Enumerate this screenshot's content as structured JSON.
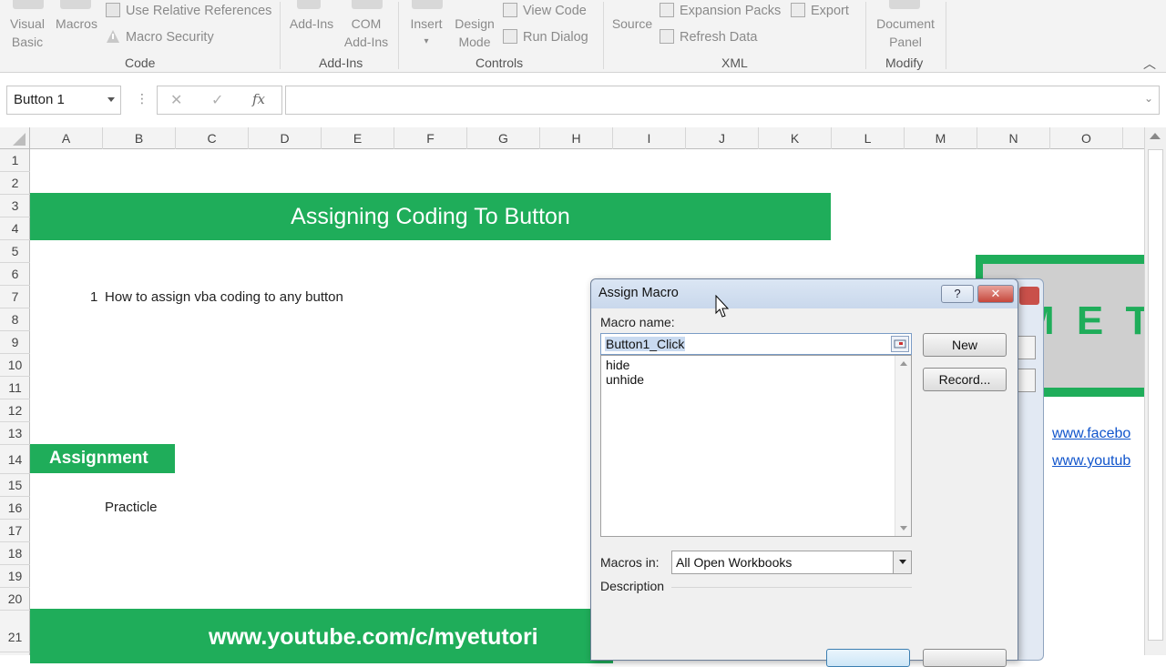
{
  "ribbon": {
    "visual_basic": [
      "Visual",
      "Basic"
    ],
    "macros": "Macros",
    "use_relative": "Use Relative References",
    "macro_security": "Macro Security",
    "group_code": "Code",
    "add_ins": "Add-Ins",
    "com_add_ins": [
      "COM",
      "Add-Ins"
    ],
    "group_addins": "Add-Ins",
    "insert": "Insert",
    "design_mode": [
      "Design",
      "Mode"
    ],
    "view_code": "View Code",
    "run_dialog": "Run Dialog",
    "group_controls": "Controls",
    "source": "Source",
    "expansion_packs": "Expansion Packs",
    "export": "Export",
    "refresh_data": "Refresh Data",
    "group_xml": "XML",
    "document_panel": [
      "Document",
      "Panel"
    ],
    "group_modify": "Modify"
  },
  "formula_bar": {
    "name_box": "Button 1",
    "cancel_glyph": "✕",
    "enter_glyph": "✓",
    "fx_glyph": "fx",
    "formula": ""
  },
  "columns": [
    "A",
    "B",
    "C",
    "D",
    "E",
    "F",
    "G",
    "H",
    "I",
    "J",
    "K",
    "L",
    "M",
    "N",
    "O"
  ],
  "rows": [
    "1",
    "2",
    "3",
    "4",
    "5",
    "6",
    "7",
    "8",
    "9",
    "10",
    "11",
    "12",
    "13",
    "14",
    "15",
    "16",
    "17",
    "18",
    "19",
    "20",
    "21"
  ],
  "sheet": {
    "title": "Assigning Coding To Button",
    "item_num": "1",
    "item_text": "How to assign vba coding to any button",
    "assignment": "Assignment",
    "practicle": "Practicle",
    "footer": "www.youtube.com/c/myetutori",
    "link_facebook": "www.facebo",
    "link_youtube": "www.youtub",
    "logo_text": "M E T"
  },
  "dialog": {
    "title": "Assign Macro",
    "help": "?",
    "close": "✕",
    "macro_name_label": "Macro name:",
    "macro_name_value": "Button1_Click",
    "list": [
      "hide",
      "unhide"
    ],
    "btn_new": "New",
    "btn_record": "Record...",
    "macros_in_label": "Macros in:",
    "macros_in_value": "All Open Workbooks",
    "description_label": "Description"
  },
  "colors": {
    "accent_green": "#1fad5a",
    "link_blue": "#1155cc"
  }
}
